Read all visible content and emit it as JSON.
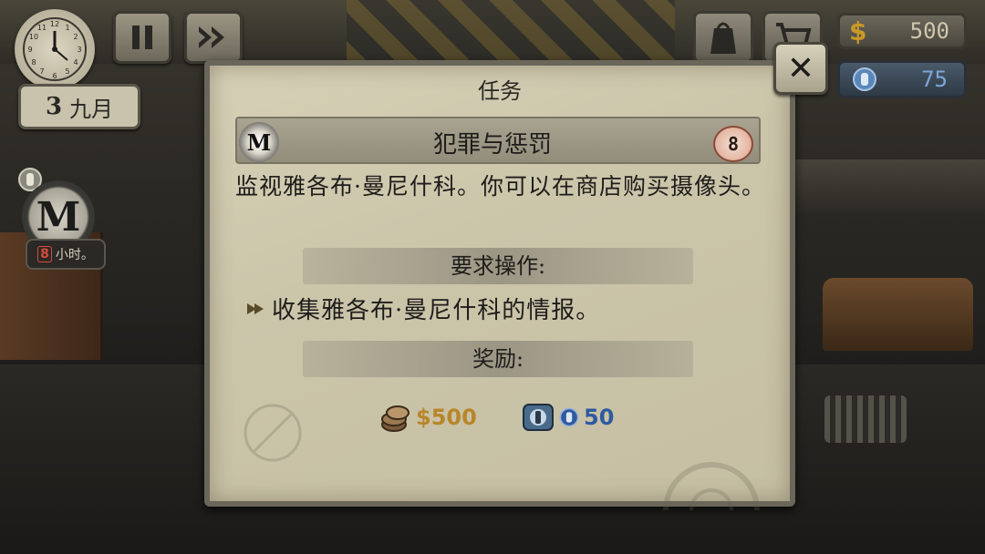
{
  "hud": {
    "date_day": "3",
    "date_month": "九月",
    "money": "500",
    "money_symbol": "$",
    "reputation": "75"
  },
  "side_task": {
    "letter": "M",
    "timer_num": "8",
    "timer_unit": "小时。"
  },
  "dialog": {
    "title": "任务",
    "task_letter": "M",
    "task_name": "犯罪与惩罚",
    "task_badge": "8",
    "description": "监视雅各布·曼尼什科。你可以在商店购买摄像头。",
    "requirements_label": "要求操作:",
    "requirement_item": "收集雅各布·曼尼什科的情报。",
    "rewards_label": "奖励:",
    "reward_money": "$500",
    "reward_reputation": "50"
  },
  "icons": [
    "clock-icon",
    "pause-icon",
    "fast-forward-icon",
    "inventory-bag-icon",
    "shopping-cart-icon",
    "dollar-icon",
    "reputation-emblem-icon",
    "close-icon",
    "coins-icon",
    "arrow-bullet-icon"
  ],
  "colors": {
    "parchment": "#cfc9ae",
    "money_gold": "#b8862a",
    "reputation_blue": "#2f5aa0",
    "badge_red": "#d84a3a"
  }
}
